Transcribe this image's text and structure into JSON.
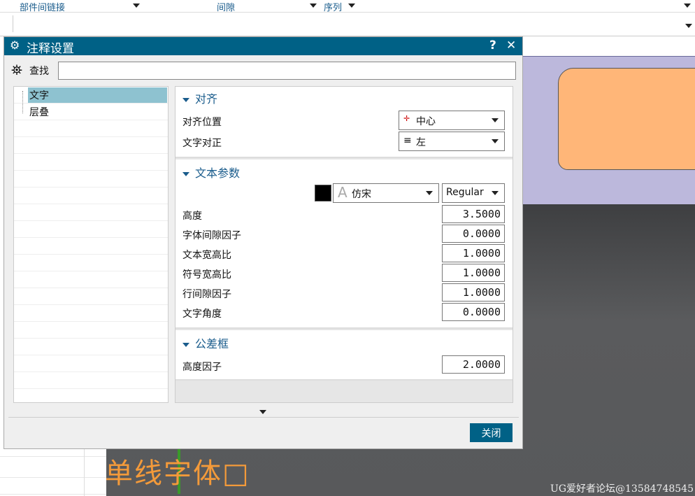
{
  "topbar": {
    "col1": "部件间链接",
    "col2": "间隙",
    "col3": "序列"
  },
  "dialog": {
    "title": "注释设置",
    "help": "?",
    "close_x": "✕",
    "search_label": "查找",
    "search_value": "",
    "tree": [
      {
        "label": "文字"
      },
      {
        "label": "层叠"
      }
    ],
    "align": {
      "header": "对齐",
      "position_label": "对齐位置",
      "position_value": "中心",
      "justify_label": "文字对正",
      "justify_value": "左"
    },
    "text": {
      "header": "文本参数",
      "color": "#000000",
      "font": "仿宋",
      "style": "Regular",
      "rows": [
        {
          "label": "高度",
          "value": "3.5000"
        },
        {
          "label": "字体间隙因子",
          "value": "0.0000"
        },
        {
          "label": "文本宽高比",
          "value": "1.0000"
        },
        {
          "label": "符号宽高比",
          "value": "1.0000"
        },
        {
          "label": "行间隙因子",
          "value": "1.0000"
        },
        {
          "label": "文字角度",
          "value": "0.0000"
        }
      ]
    },
    "tolerance": {
      "header": "公差框",
      "height_factor_label": "高度因子",
      "height_factor_value": "2.0000"
    },
    "close_button": "关闭"
  },
  "viewport": {
    "text": "单线字体□",
    "watermark": "UG爱好者论坛@13584748545"
  }
}
